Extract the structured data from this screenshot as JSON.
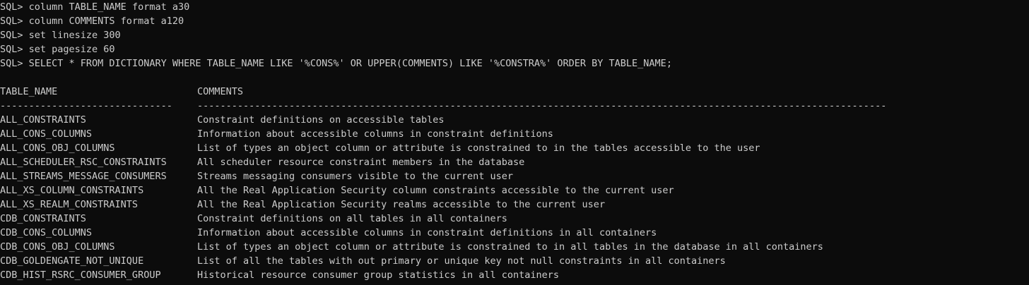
{
  "terminal": {
    "commands": [
      {
        "prompt": "SQL> ",
        "text": "column TABLE_NAME format a30"
      },
      {
        "prompt": "SQL> ",
        "text": "column COMMENTS format a120"
      },
      {
        "prompt": "SQL> ",
        "text": "set linesize 300"
      },
      {
        "prompt": "SQL> ",
        "text": "set pagesize 60"
      },
      {
        "prompt": "SQL> ",
        "text": "SELECT * FROM DICTIONARY WHERE TABLE_NAME LIKE '%CONS%' OR UPPER(COMMENTS) LIKE '%CONSTRA%' ORDER BY TABLE_NAME;"
      }
    ],
    "result": {
      "headers": {
        "table_name": "TABLE_NAME",
        "comments": "COMMENTS"
      },
      "separators": {
        "table_name": "------------------------------",
        "comments": "------------------------------------------------------------------------------------------------------------------------"
      },
      "rows": [
        {
          "table_name": "ALL_CONSTRAINTS",
          "comments": "Constraint definitions on accessible tables"
        },
        {
          "table_name": "ALL_CONS_COLUMNS",
          "comments": "Information about accessible columns in constraint definitions"
        },
        {
          "table_name": "ALL_CONS_OBJ_COLUMNS",
          "comments": "List of types an object column or attribute is constrained to in the tables accessible to the user"
        },
        {
          "table_name": "ALL_SCHEDULER_RSC_CONSTRAINTS",
          "comments": "All scheduler resource constraint members in the database"
        },
        {
          "table_name": "ALL_STREAMS_MESSAGE_CONSUMERS",
          "comments": "Streams messaging consumers visible to the current user"
        },
        {
          "table_name": "ALL_XS_COLUMN_CONSTRAINTS",
          "comments": "All the Real Application Security column constraints accessible to the current user"
        },
        {
          "table_name": "ALL_XS_REALM_CONSTRAINTS",
          "comments": "All the Real Application Security realms accessible to the current user"
        },
        {
          "table_name": "CDB_CONSTRAINTS",
          "comments": "Constraint definitions on all tables in all containers"
        },
        {
          "table_name": "CDB_CONS_COLUMNS",
          "comments": "Information about accessible columns in constraint definitions in all containers"
        },
        {
          "table_name": "CDB_CONS_OBJ_COLUMNS",
          "comments": "List of types an object column or attribute is constrained to in all tables in the database in all containers"
        },
        {
          "table_name": "CDB_GOLDENGATE_NOT_UNIQUE",
          "comments": "List of all the tables with out primary or unique key not null constraints in all containers"
        },
        {
          "table_name": "CDB_HIST_RSRC_CONSUMER_GROUP",
          "comments": "Historical resource consumer group statistics in all containers"
        }
      ]
    }
  }
}
